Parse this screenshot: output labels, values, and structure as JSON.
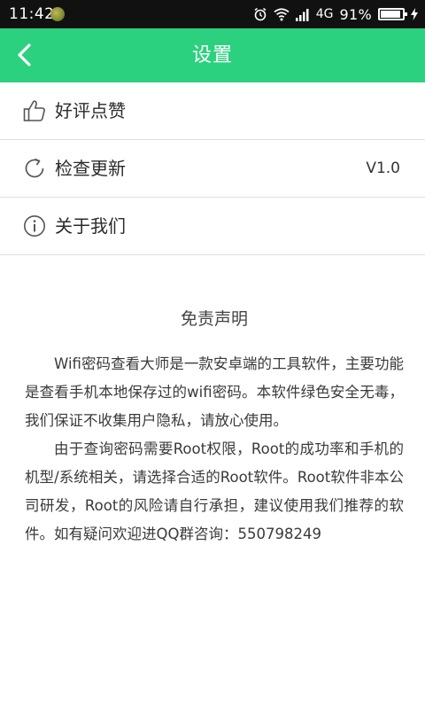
{
  "status_bar": {
    "time": "11:42",
    "network": "4G",
    "battery_percent": "91%",
    "battery_level": 0.91,
    "icons": [
      "app-notification-icon",
      "alarm-icon",
      "wifi-icon",
      "signal-icon",
      "battery-icon",
      "charging-icon"
    ]
  },
  "header": {
    "title": "设置",
    "back_icon": "chevron-left-icon",
    "background_color": "#2cd17f"
  },
  "menu": {
    "items": [
      {
        "label": "好评点赞",
        "icon": "thumbs-up-icon",
        "value": ""
      },
      {
        "label": "检查更新",
        "icon": "refresh-icon",
        "value": "V1.0"
      },
      {
        "label": "关于我们",
        "icon": "info-icon",
        "value": ""
      }
    ]
  },
  "disclaimer": {
    "title": "免责声明",
    "paragraphs": [
      "Wifi密码查看大师是一款安卓端的工具软件，主要功能是查看手机本地保存过的wifi密码。本软件绿色安全无毒，我们保证不收集用户隐私，请放心使用。",
      "由于查询密码需要Root权限，Root的成功率和手机的机型/系统相关，请选择合适的Root软件。Root软件非本公司研发，Root的风险请自行承担，建议使用我们推荐的软件。如有疑问欢迎进QQ群咨询：550798249"
    ]
  }
}
